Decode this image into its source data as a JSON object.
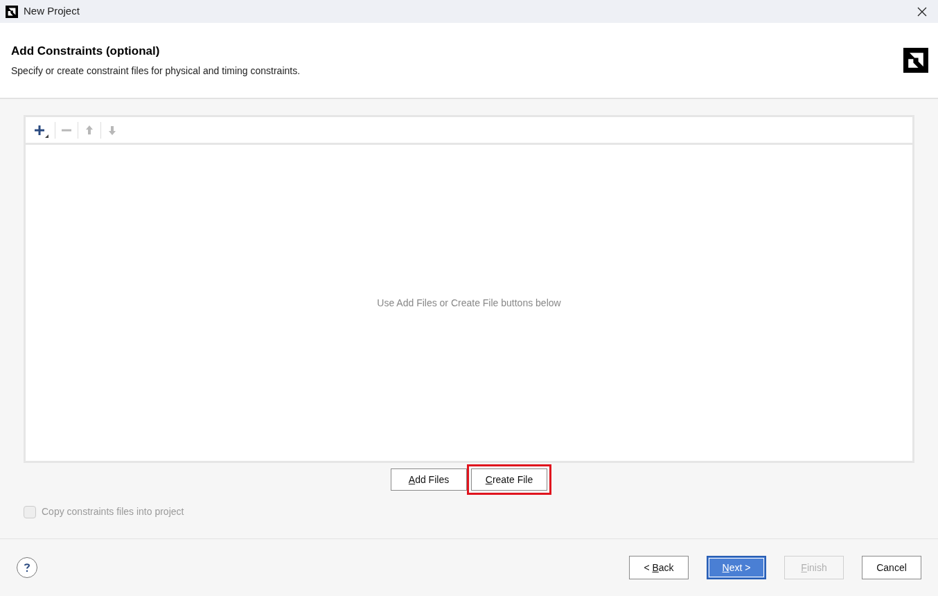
{
  "window": {
    "title": "New Project"
  },
  "header": {
    "title": "Add Constraints (optional)",
    "subtitle": "Specify or create constraint files for physical and timing constraints."
  },
  "toolbar": [
    {
      "kind": "add",
      "disabled": false
    },
    {
      "kind": "remove",
      "disabled": true
    },
    {
      "kind": "up",
      "disabled": true
    },
    {
      "kind": "down",
      "disabled": true
    }
  ],
  "file_list": {
    "empty_message": "Use Add Files or Create File buttons below"
  },
  "file_buttons": [
    {
      "key": "A",
      "post": "dd Files",
      "highlighted": false
    },
    {
      "key": "C",
      "post": "reate File",
      "highlighted": true
    }
  ],
  "copy_option": {
    "label": "Copy constraints files into project",
    "checked": false,
    "disabled": true
  },
  "nav_buttons": [
    {
      "pre": "< ",
      "key": "B",
      "post": "ack",
      "kind": "normal",
      "disabled": false
    },
    {
      "key": "N",
      "post": "ext >",
      "kind": "primary",
      "disabled": false
    },
    {
      "key": "F",
      "post": "inish",
      "kind": "normal",
      "disabled": true
    },
    {
      "post": "Cancel",
      "kind": "normal",
      "disabled": false
    }
  ]
}
